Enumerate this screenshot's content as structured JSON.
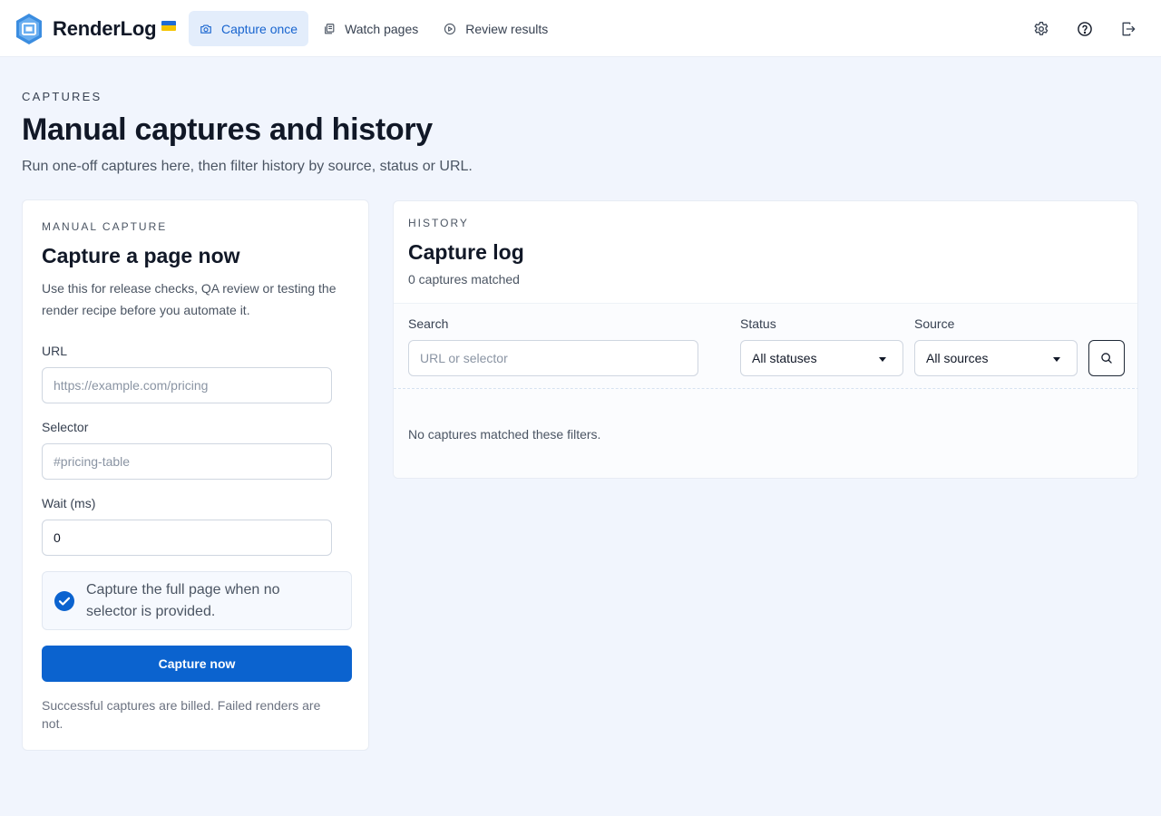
{
  "app": {
    "name": "RenderLog",
    "colors": {
      "accent": "#0b63cf",
      "nav_active_bg": "#e3edfb",
      "page_bg": "#f1f5fd"
    }
  },
  "nav": {
    "items": [
      {
        "label": "Capture once",
        "icon": "camera-icon",
        "active": true
      },
      {
        "label": "Watch pages",
        "icon": "copy-icon",
        "active": false
      },
      {
        "label": "Review results",
        "icon": "play-circle-icon",
        "active": false
      }
    ]
  },
  "toolbar": {
    "icons": [
      "gear-icon",
      "help-circle-icon",
      "logout-icon"
    ]
  },
  "header": {
    "eyebrow": "CAPTURES",
    "title": "Manual captures and history",
    "subtitle": "Run one-off captures here, then filter history by source, status or URL."
  },
  "manual": {
    "eyebrow": "MANUAL CAPTURE",
    "title": "Capture a page now",
    "description": "Use this for release checks, QA review or testing the render recipe before you automate it.",
    "url_label": "URL",
    "url_placeholder": "https://example.com/pricing",
    "url_value": "",
    "selector_label": "Selector",
    "selector_placeholder": "#pricing-table",
    "selector_value": "",
    "wait_label": "Wait (ms)",
    "wait_value": "0",
    "full_page_checked": true,
    "full_page_label": "Capture the full page when no selector is provided.",
    "button": "Capture now",
    "note": "Successful captures are billed. Failed renders are not."
  },
  "history": {
    "eyebrow": "HISTORY",
    "title": "Capture log",
    "count": "0 captures matched",
    "search_label": "Search",
    "search_placeholder": "URL or selector",
    "search_value": "",
    "status_label": "Status",
    "status_selected": "All statuses",
    "source_label": "Source",
    "source_selected": "All sources",
    "empty": "No captures matched these filters."
  }
}
